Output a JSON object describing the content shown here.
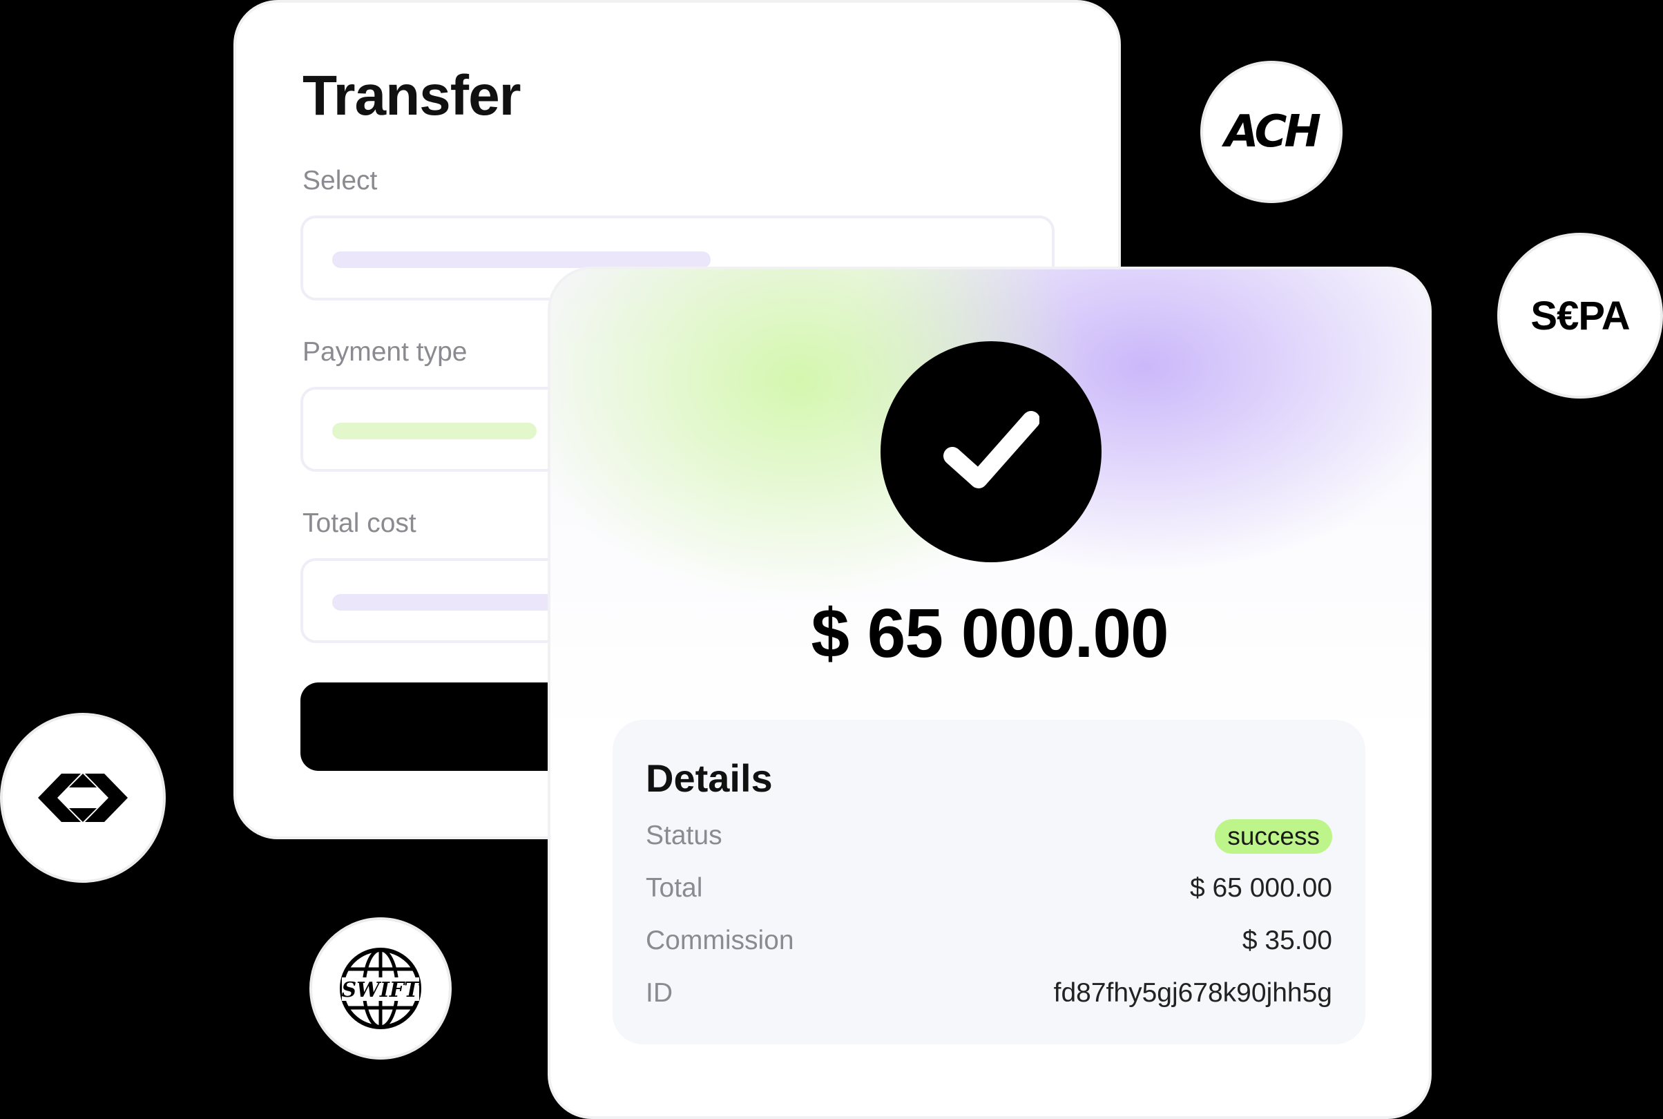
{
  "transfer": {
    "title": "Transfer",
    "fields": [
      {
        "label": "Select",
        "bar_color": "#ece6fb"
      },
      {
        "label": "Payment type",
        "bar_color": "#e2f8cc"
      },
      {
        "label": "Total cost",
        "bar_color": "#ece6fb"
      }
    ]
  },
  "result": {
    "amount": "$ 65 000.00",
    "details": {
      "title": "Details",
      "status_label": "Status",
      "status_value": "success",
      "total_label": "Total",
      "total_value": "$ 65 000.00",
      "commission_label": "Commission",
      "commission_value": "$ 35.00",
      "id_label": "ID",
      "id_value": "fd87fhy5gj678k90jhh5g"
    }
  },
  "logos": {
    "ach": {
      "text": "ACH",
      "icon": "ach-logo-icon"
    },
    "sepa": {
      "text": "S€PA",
      "icon": "sepa-logo-icon"
    },
    "swift": {
      "text": "SWIFT",
      "icon": "swift-globe-icon"
    },
    "generic": {
      "icon": "diamond-bank-icon"
    }
  },
  "colors": {
    "success_badge": "#bdf58a",
    "accent_green": "#d2f7aa",
    "accent_purple": "#c8b4fa"
  }
}
